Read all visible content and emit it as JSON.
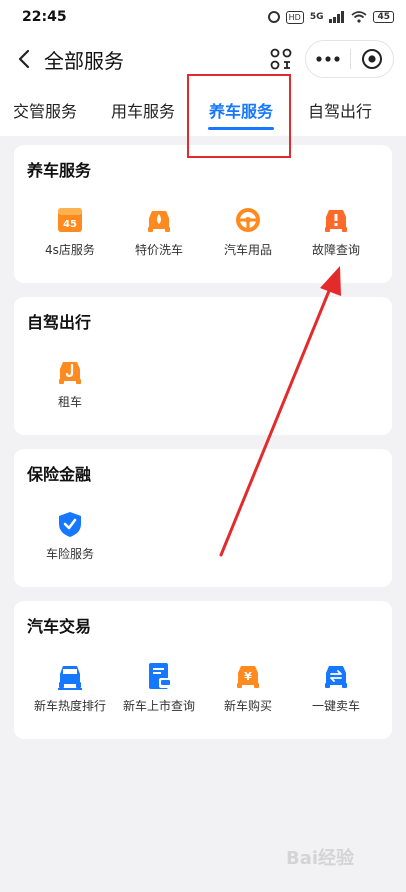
{
  "status_bar": {
    "time": "22:45",
    "battery": "45",
    "hd": "HD",
    "net": "5G"
  },
  "header": {
    "title": "全部服务",
    "back_icon": "back-chevron-icon",
    "scan_icon": "scan-icon",
    "more_icon": "more-dots-icon",
    "close_icon": "miniapp-close-icon"
  },
  "tabs": [
    {
      "label": "交管服务",
      "active": false
    },
    {
      "label": "用车服务",
      "active": false
    },
    {
      "label": "养车服务",
      "active": true
    },
    {
      "label": "自驾出行",
      "active": false
    }
  ],
  "sections": [
    {
      "title": "养车服务",
      "items": [
        {
          "label": "4s店服务",
          "icon": "4s-store-icon",
          "color": "#ff8a1f",
          "badge": "4S"
        },
        {
          "label": "特价洗车",
          "icon": "car-wash-icon",
          "color": "#ff8a1f"
        },
        {
          "label": "汽车用品",
          "icon": "steering-wheel-icon",
          "color": "#ff8a1f"
        },
        {
          "label": "故障查询",
          "icon": "car-fault-icon",
          "color": "#ff6a2a"
        }
      ]
    },
    {
      "title": "自驾出行",
      "items": [
        {
          "label": "租车",
          "icon": "car-rental-icon",
          "color": "#ff8a1f"
        }
      ]
    },
    {
      "title": "保险金融",
      "items": [
        {
          "label": "车险服务",
          "icon": "insurance-shield-icon",
          "color": "#1677ff"
        }
      ]
    },
    {
      "title": "汽车交易",
      "items": [
        {
          "label": "新车热度排行",
          "icon": "car-ranking-icon",
          "color": "#1677ff"
        },
        {
          "label": "新车上市查询",
          "icon": "new-car-doc-icon",
          "color": "#1677ff"
        },
        {
          "label": "新车购买",
          "icon": "car-buy-icon",
          "color": "#ff8a1f",
          "badge": "¥"
        },
        {
          "label": "一键卖车",
          "icon": "car-sell-icon",
          "color": "#1677ff"
        }
      ]
    }
  ],
  "accent_color": "#1677ff",
  "annotation_color": "#e32b2b",
  "watermark": "Bai经验"
}
